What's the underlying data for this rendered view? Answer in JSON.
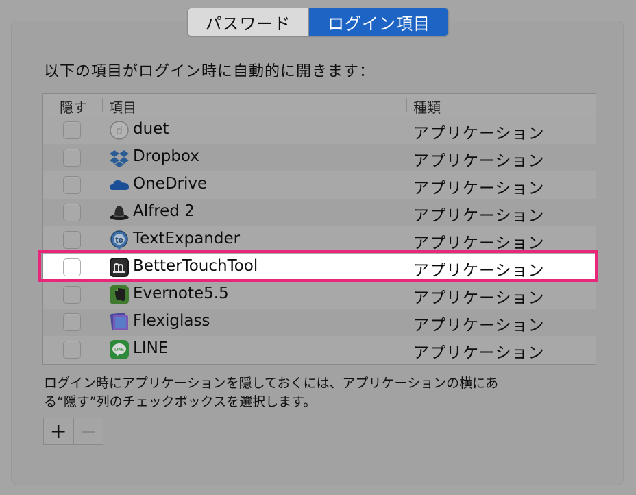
{
  "tabs": {
    "password": "パスワード",
    "login_items": "ログイン項目"
  },
  "heading": "以下の項目がログイン時に自動的に開きます：",
  "table": {
    "columns": {
      "hide": "隠す",
      "item": "項目",
      "kind": "種類"
    },
    "rows": [
      {
        "name": "duet",
        "kind": "アプリケーション",
        "icon": "duet-icon",
        "hidden": false
      },
      {
        "name": "Dropbox",
        "kind": "アプリケーション",
        "icon": "dropbox-icon",
        "hidden": false
      },
      {
        "name": "OneDrive",
        "kind": "アプリケーション",
        "icon": "onedrive-icon",
        "hidden": false
      },
      {
        "name": "Alfred 2",
        "kind": "アプリケーション",
        "icon": "alfred-icon",
        "hidden": false
      },
      {
        "name": "TextExpander",
        "kind": "アプリケーション",
        "icon": "textexpander-icon",
        "hidden": false
      },
      {
        "name": "BetterTouchTool",
        "kind": "アプリケーション",
        "icon": "bettertouchtool-icon",
        "hidden": false
      },
      {
        "name": "Evernote5.5",
        "kind": "アプリケーション",
        "icon": "evernote-icon",
        "hidden": false
      },
      {
        "name": "Flexiglass",
        "kind": "アプリケーション",
        "icon": "flexiglass-icon",
        "hidden": false
      },
      {
        "name": "LINE",
        "kind": "アプリケーション",
        "icon": "line-icon",
        "hidden": false
      }
    ]
  },
  "note": {
    "line1": "ログイン時にアプリケーションを隠しておくには、アプリケーションの横にあ",
    "line2": "る“隠す”列のチェックボックスを選択します。"
  },
  "buttons": {
    "add": "+",
    "remove": "−"
  },
  "colors": {
    "selected_tab": "#1d64c4",
    "highlight_frame": "#e8277a"
  }
}
